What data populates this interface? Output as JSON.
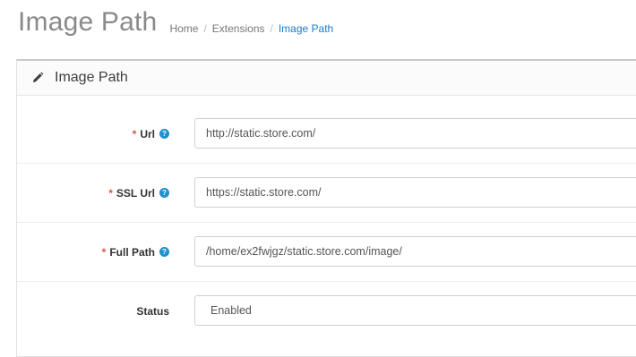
{
  "header": {
    "title": "Image Path",
    "breadcrumb": [
      {
        "label": "Home"
      },
      {
        "label": "Extensions"
      },
      {
        "label": "Image Path"
      }
    ],
    "separator": "/"
  },
  "panel": {
    "heading_icon": "pencil-icon",
    "heading": "Image Path"
  },
  "form": {
    "required_mark": "*",
    "help_glyph": "?",
    "url": {
      "label": "Url",
      "value": "http://static.store.com/"
    },
    "ssl_url": {
      "label": "SSL Url",
      "value": "https://static.store.com/"
    },
    "full_path": {
      "label": "Full Path",
      "value": "/home/ex2fwjgz/static.store.com/image/"
    },
    "status": {
      "label": "Status",
      "selected": "Enabled"
    }
  },
  "colors": {
    "accent": "#1e91cf",
    "link_active": "#1e7ac2",
    "required": "#e3503e",
    "title": "#8a8a8a"
  }
}
